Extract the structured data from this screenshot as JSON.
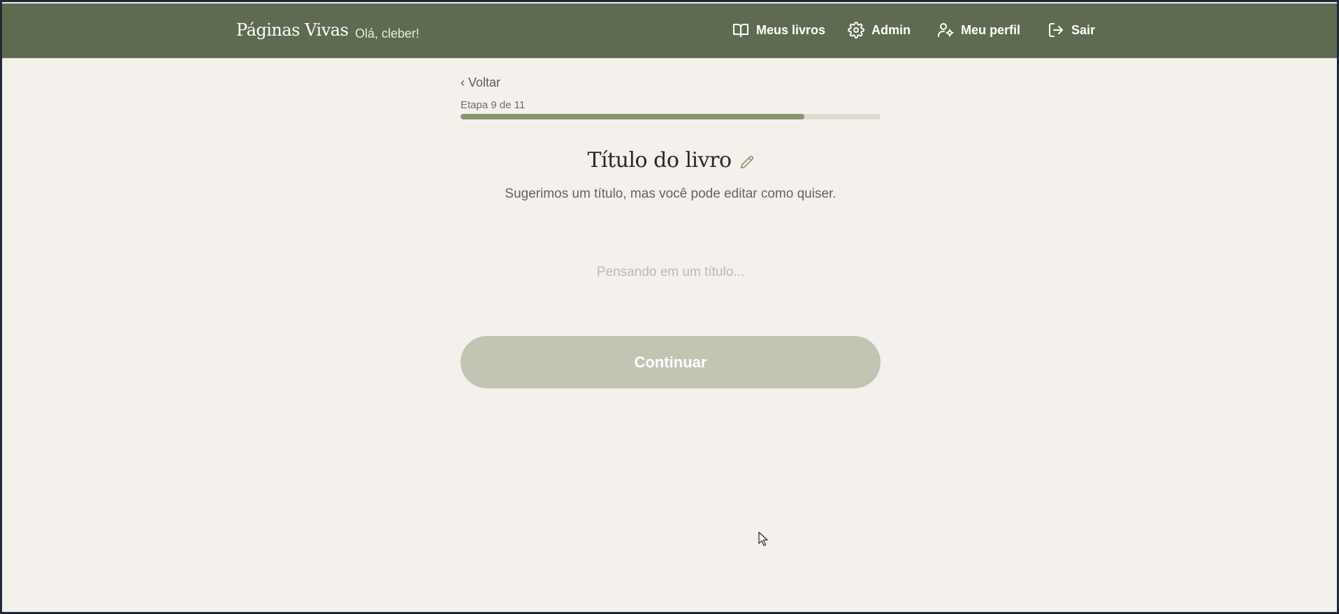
{
  "header": {
    "brand": "Páginas Vivas",
    "greeting": "Olá, cleber!",
    "nav": {
      "my_books": "Meus livros",
      "admin": "Admin",
      "my_profile": "Meu perfil",
      "logout": "Sair"
    }
  },
  "wizard": {
    "back_label": "‹ Voltar",
    "step_label": "Etapa 9 de 11",
    "current_step": 9,
    "total_steps": 11,
    "title": "Título do livro",
    "subtitle": "Sugerimos um título, mas você pode editar como quiser.",
    "title_input": {
      "value": "",
      "placeholder": "Pensando em um título..."
    },
    "continue_label": "Continuar"
  },
  "colors": {
    "header_bg": "#5f6b50",
    "page_bg": "#f4f1ec",
    "progress_fill": "#86966f",
    "progress_track": "#dfd9d0",
    "button_disabled": "#c1c5b3"
  },
  "icons": {
    "my_books": "open-book-icon",
    "admin": "gear-icon",
    "my_profile": "user-gear-icon",
    "logout": "logout-icon",
    "edit_title": "pencil-icon"
  }
}
